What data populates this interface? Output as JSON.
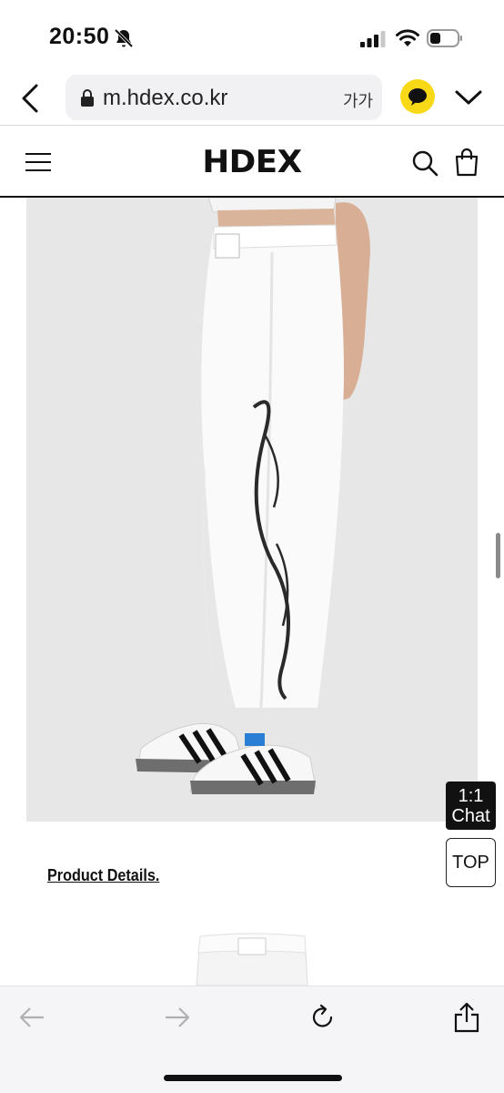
{
  "status_bar": {
    "time": "20:50"
  },
  "browser": {
    "url": "m.hdex.co.kr",
    "text_size_label": "가가"
  },
  "site": {
    "logo": "HDEX"
  },
  "product": {
    "details_link": "Product Details."
  },
  "floating": {
    "chat_line1": "1:1",
    "chat_line2": "Chat",
    "top_label": "TOP"
  },
  "colors": {
    "kakao_yellow": "#f7d917",
    "text": "#111111",
    "toolbar_bg": "#f5f5f7"
  },
  "icons": [
    "bell-slash-icon",
    "signal-icon",
    "wifi-icon",
    "battery-icon",
    "back-icon",
    "lock-icon",
    "kakao-chat-icon",
    "chevron-down-icon",
    "menu-icon",
    "search-icon",
    "cart-icon",
    "nav-back-icon",
    "nav-forward-icon",
    "reload-icon",
    "share-icon"
  ]
}
